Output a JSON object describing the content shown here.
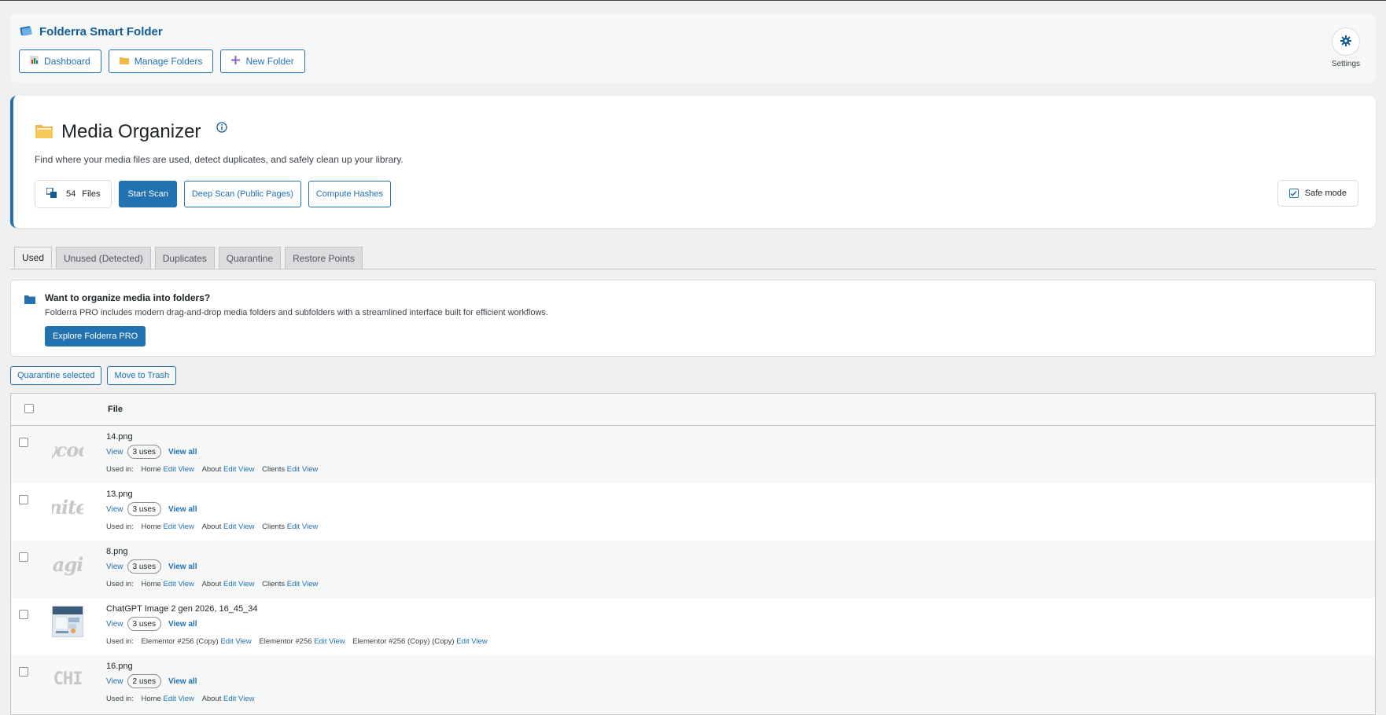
{
  "header": {
    "brand_title": "Folderra Smart Folder",
    "buttons": {
      "dashboard": "Dashboard",
      "manage_folders": "Manage Folders",
      "new_folder": "New Folder"
    },
    "settings_label": "Settings"
  },
  "organizer": {
    "title": "Media Organizer",
    "description": "Find where your media files are used, detect duplicates, and safely clean up your library.",
    "files_count": "54",
    "files_label": "Files",
    "start_scan": "Start Scan",
    "deep_scan": "Deep Scan (Public Pages)",
    "compute_hashes": "Compute Hashes",
    "safe_mode": "Safe mode"
  },
  "tabs": [
    "Used",
    "Unused (Detected)",
    "Duplicates",
    "Quarantine",
    "Restore Points"
  ],
  "promo": {
    "title": "Want to organize media into folders?",
    "description": "Folderra PRO includes modern drag-and-drop media folders and subfolders with a streamlined interface built for efficient workflows.",
    "button": "Explore Folderra PRO"
  },
  "bulk": {
    "quarantine": "Quarantine selected",
    "trash": "Move to Trash"
  },
  "table": {
    "column_file": "File",
    "labels": {
      "view": "View",
      "view_all": "View all",
      "used_in": "Used in:",
      "edit": "Edit",
      "view_link": "View"
    },
    "rows": [
      {
        "thumb": "ycoo",
        "name": "14.png",
        "uses": "3 uses",
        "pages": [
          "Home",
          "About",
          "Clients"
        ]
      },
      {
        "thumb": "nite",
        "name": "13.png",
        "uses": "3 uses",
        "pages": [
          "Home",
          "About",
          "Clients"
        ]
      },
      {
        "thumb": "agi",
        "name": "8.png",
        "uses": "3 uses",
        "pages": [
          "Home",
          "About",
          "Clients"
        ]
      },
      {
        "thumb": "",
        "name": "ChatGPT Image 2 gen 2026, 16_45_34",
        "uses": "3 uses",
        "pages": [
          "Elementor #256 (Copy)",
          "Elementor #256",
          "Elementor #256 (Copy) (Copy)"
        ]
      },
      {
        "thumb": "CHI",
        "name": "16.png",
        "uses": "2 uses",
        "pages": [
          "Home",
          "About"
        ]
      }
    ]
  },
  "colors": {
    "accent": "#2271b1",
    "accent_dark": "#135e96",
    "background": "#f0f0f1"
  }
}
